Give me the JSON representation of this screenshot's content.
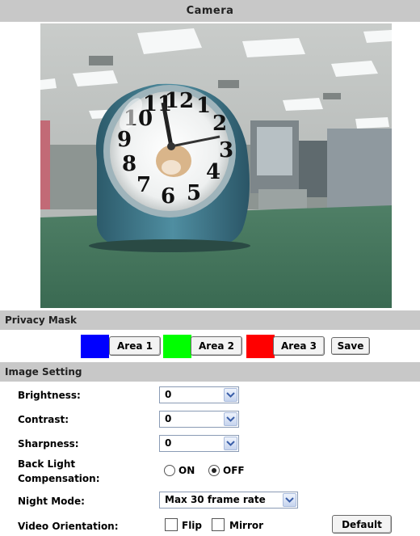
{
  "header": {
    "title": "Camera"
  },
  "camera": {
    "clock_numbers": [
      "12",
      "1",
      "2",
      "3",
      "4",
      "5",
      "6",
      "7",
      "8",
      "9",
      "10",
      "11"
    ]
  },
  "privacy_mask": {
    "title": "Privacy Mask",
    "areas": [
      {
        "label": "Area 1",
        "color": "#0000ff"
      },
      {
        "label": "Area 2",
        "color": "#00ff00"
      },
      {
        "label": "Area 3",
        "color": "#ff0000"
      }
    ],
    "save_label": "Save"
  },
  "image_setting": {
    "title": "Image Setting",
    "brightness": {
      "label": "Brightness:",
      "value": "0"
    },
    "contrast": {
      "label": "Contrast:",
      "value": "0"
    },
    "sharpness": {
      "label": "Sharpness:",
      "value": "0"
    },
    "back_light": {
      "label_line1": "Back Light",
      "label_line2": "Compensation:",
      "on_label": "ON",
      "off_label": "OFF",
      "selected": "OFF"
    },
    "night_mode": {
      "label": "Night Mode:",
      "value": "Max 30 frame rate"
    },
    "video_orientation": {
      "label": "Video Orientation:",
      "flip_label": "Flip",
      "mirror_label": "Mirror",
      "flip_checked": false,
      "mirror_checked": false
    },
    "default_label": "Default"
  },
  "colors": {
    "section_bg": "#c8c8c8",
    "select_border": "#8a9bb5"
  }
}
